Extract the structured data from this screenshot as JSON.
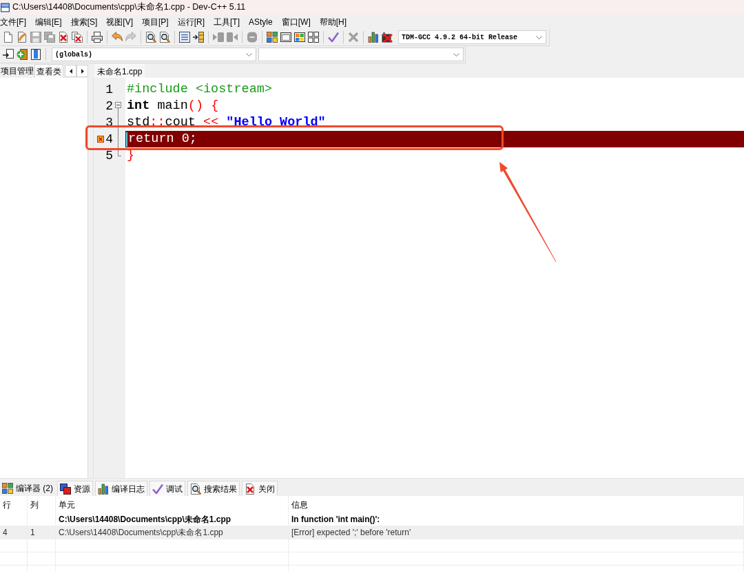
{
  "window": {
    "title": "C:\\Users\\14408\\Documents\\cpp\\未命名1.cpp - Dev-C++ 5.11"
  },
  "menu": [
    "文件[F]",
    "编辑[E]",
    "搜索[S]",
    "视图[V]",
    "项目[P]",
    "运行[R]",
    "工具[T]",
    "AStyle",
    "窗口[W]",
    "帮助[H]"
  ],
  "toolbar": {
    "groups": [
      {
        "buttons": [
          {
            "disabled": false
          },
          {
            "disabled": false
          },
          {
            "disabled": true
          },
          {
            "disabled": true
          },
          {
            "disabled": false
          },
          {
            "disabled": false
          }
        ]
      },
      {
        "buttons": [
          {
            "disabled": false
          }
        ]
      },
      {
        "buttons": [
          {
            "disabled": false
          },
          {
            "disabled": true
          }
        ]
      },
      {
        "buttons": [
          {
            "disabled": false
          },
          {
            "disabled": false
          }
        ]
      },
      {
        "buttons": [
          {
            "disabled": false
          },
          {
            "disabled": false
          }
        ]
      },
      {
        "buttons": [
          {
            "disabled": true
          },
          {
            "disabled": true
          }
        ]
      },
      {
        "buttons": [
          {
            "disabled": true
          }
        ]
      },
      {
        "buttons": [
          {
            "disabled": false
          },
          {
            "disabled": false
          },
          {
            "disabled": false
          },
          {
            "disabled": false
          }
        ]
      },
      {
        "buttons": [
          {
            "disabled": false
          }
        ]
      },
      {
        "buttons": [
          {
            "disabled": true
          }
        ]
      },
      {
        "buttons": [
          {
            "disabled": false
          },
          {
            "disabled": false
          }
        ]
      }
    ],
    "compiler": "TDM-GCC 4.9.2 64-bit Release"
  },
  "code_toolbar": {
    "buttons": [
      {
        "disabled": false
      },
      {
        "disabled": false
      },
      {
        "disabled": false
      }
    ],
    "scope": "(globals)"
  },
  "side_panel": {
    "tabs": [
      {
        "label": "项目管理",
        "selected": true
      },
      {
        "label": "查看类",
        "selected": false
      }
    ]
  },
  "editor": {
    "tabs": [
      {
        "label": "未命名1.cpp",
        "selected": true
      }
    ],
    "lines": [
      {
        "number": "1",
        "error": false,
        "caret": false,
        "tokens": [
          {
            "kind": "preprocessor",
            "text": "#include <iostream>"
          }
        ]
      },
      {
        "number": "2",
        "error": false,
        "caret": false,
        "fold": {
          "kind": "start"
        },
        "tokens": [
          {
            "kind": "keyword",
            "text": "int"
          },
          {
            "kind": "plain",
            "text": " main"
          },
          {
            "kind": "symbol",
            "text": "() {"
          }
        ]
      },
      {
        "number": "3",
        "error": false,
        "caret": false,
        "fold": {
          "kind": "body"
        },
        "tokens": [
          {
            "kind": "plain",
            "text": "std"
          },
          {
            "kind": "symbol",
            "text": "::"
          },
          {
            "kind": "plain",
            "text": "cout "
          },
          {
            "kind": "symbol",
            "text": "<<"
          },
          {
            "kind": "string",
            "text": " \"Hello World\""
          }
        ]
      },
      {
        "number": "4",
        "error": true,
        "caret": true,
        "fold": {
          "kind": "body"
        },
        "tokens": [
          {
            "kind": "plain",
            "text": "return 0;"
          }
        ]
      },
      {
        "number": "5",
        "error": false,
        "caret": false,
        "fold": {
          "kind": "end"
        },
        "tokens": [
          {
            "kind": "symbol",
            "text": "}"
          }
        ]
      }
    ]
  },
  "callout": {
    "frame": true,
    "arrow": true
  },
  "messages_panel": {
    "tabs": [
      {
        "label": "编译器 (2)",
        "selected": true
      },
      {
        "label": "资源",
        "selected": false
      },
      {
        "label": "编译日志",
        "selected": false
      },
      {
        "label": "调试",
        "selected": false
      },
      {
        "label": "搜索结果",
        "selected": false
      },
      {
        "label": "关闭",
        "selected": false
      }
    ],
    "table": {
      "columns": [
        "行",
        "列",
        "单元",
        "信息"
      ],
      "rows": [
        {
          "kind": "file",
          "selected": false,
          "unit": "C:\\Users\\14408\\Documents\\cpp\\未命名1.cpp",
          "message": "In function 'int main()':"
        },
        {
          "kind": "error",
          "selected": true,
          "line": "4",
          "column": "1",
          "unit": "C:\\Users\\14408\\Documents\\cpp\\未命名1.cpp",
          "message": "[Error] expected ';' before 'return'"
        }
      ]
    }
  }
}
